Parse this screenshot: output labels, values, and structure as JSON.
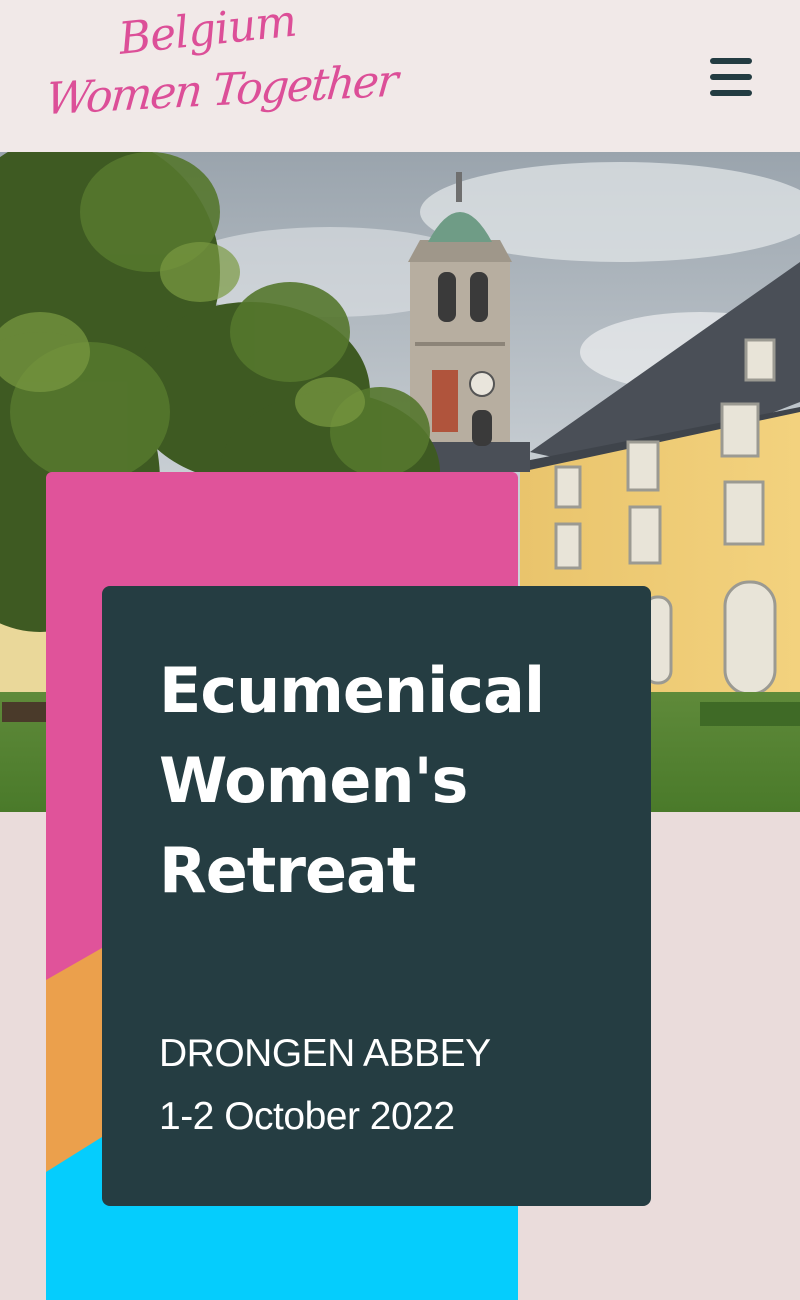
{
  "header": {
    "logo_line1": "Belgium",
    "logo_line2": "Women Together",
    "menu_icon": "hamburger-menu-icon"
  },
  "hero": {
    "image": "abbey-bell-tower-photo"
  },
  "event": {
    "title": "Ecumenical Women's Retreat",
    "location": "DRONGEN ABBEY",
    "date": "1-2 October 2022"
  },
  "colors": {
    "brand_pink": "#e0539a",
    "accent_orange": "#eba04c",
    "accent_cyan": "#05cdfd",
    "card_dark": "#253d42",
    "header_bg": "#f1e9e8",
    "page_bg": "#eadcdb"
  }
}
